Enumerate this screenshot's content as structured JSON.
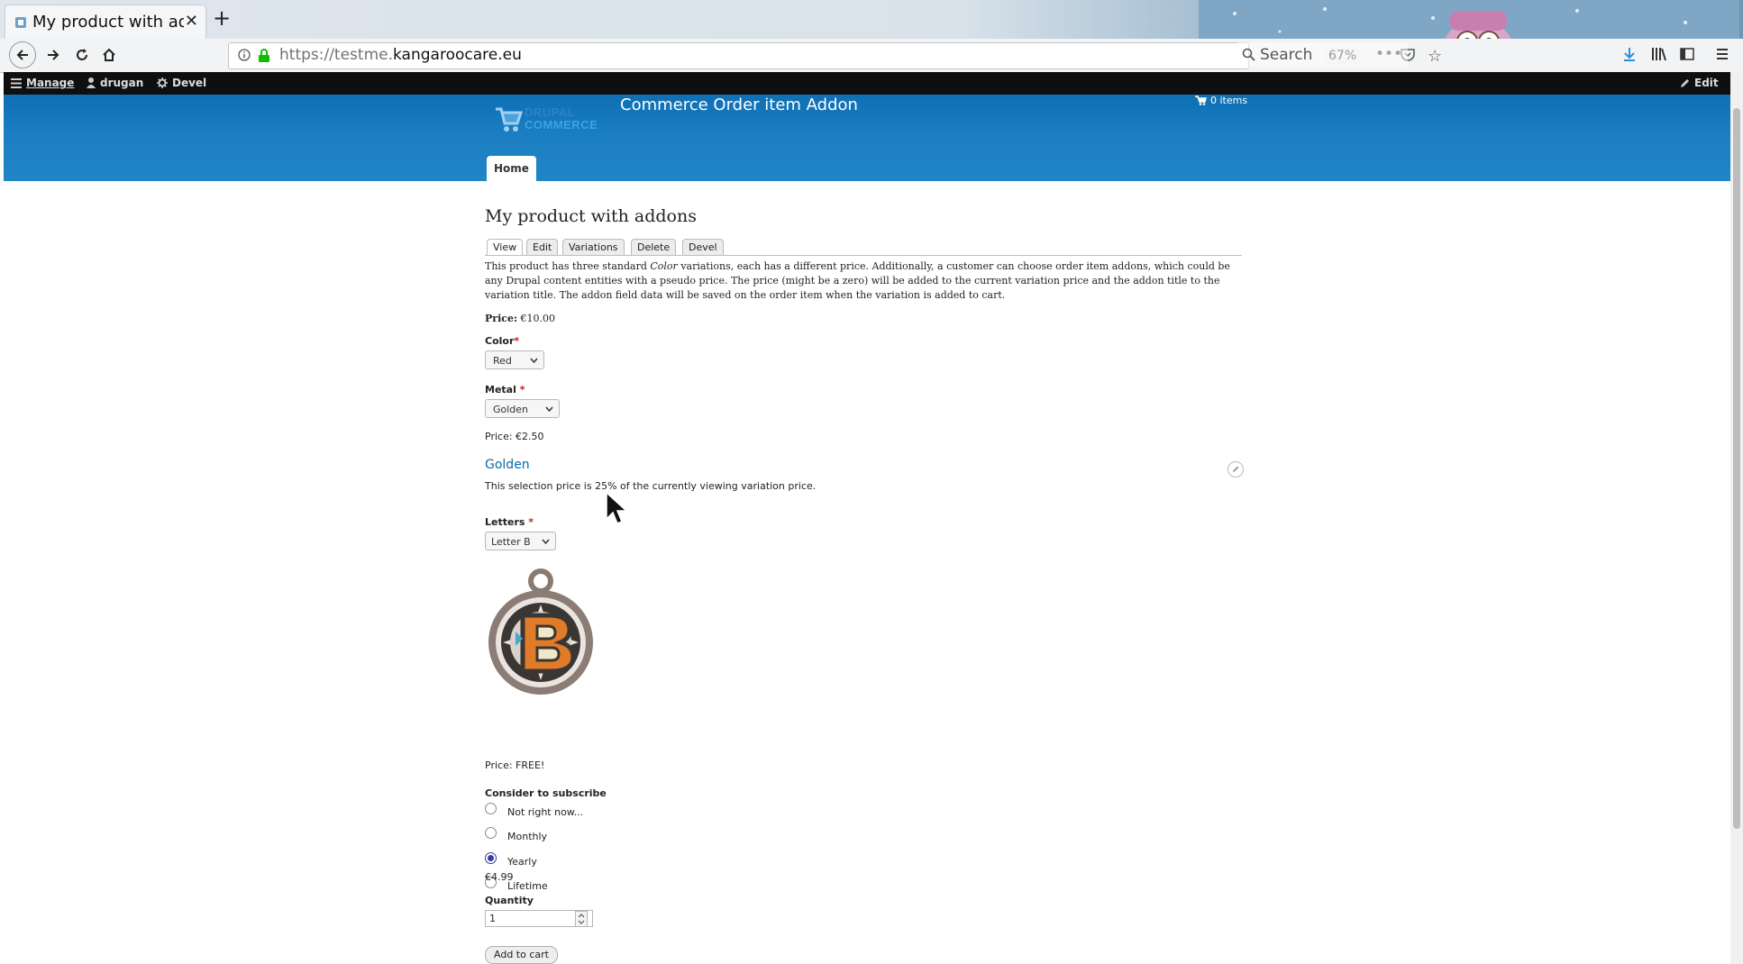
{
  "browser": {
    "tab_title": "My product with addons",
    "tab_title_visible": "My product with ad",
    "url_prefix": "https://testme.",
    "url_host": "kangaroocare.eu",
    "zoom": "67%",
    "search_placeholder": "Search"
  },
  "toolbar": {
    "manage": "Manage",
    "user": "drugan",
    "devel": "Devel",
    "edit": "Edit"
  },
  "site": {
    "logo_line1": "DRUPAL",
    "logo_line2": "COMMERCE",
    "name": "Commerce Order item Addon",
    "cart": "0 items",
    "nav_home": "Home"
  },
  "page": {
    "title": "My product with addons",
    "tabs": [
      "View",
      "Edit",
      "Variations",
      "Delete",
      "Devel"
    ],
    "description_part1": "This product has three  standard ",
    "description_em": "Color",
    "description_part2": " variations, each has a different price. Additionally, a customer can choose order item addons, which could be any Drupal content entities with a pseudo price. The price (might be a zero) will be added to the current variation price and the addon title to the variation title. The addon field data will be saved on the order item when the variation is added to cart."
  },
  "product": {
    "price_label": "Price:",
    "price_value": "€10.00",
    "color_label": "Color",
    "color_value": "Red",
    "metal_label": "Metal",
    "metal_value": "Golden",
    "metal_price": "Price: €2.50",
    "metal_link": "Golden",
    "metal_note": "This selection price is 25% of the currently viewing variation price.",
    "letters_label": "Letters",
    "letters_value": "Letter B",
    "letters_price": "Price: FREE!",
    "subscribe_label": "Consider to subscribe",
    "subscribe_options": [
      "Not right now...",
      "Monthly",
      "Yearly",
      "Lifetime"
    ],
    "subscribe_selected": "Yearly",
    "subscribe_price": "€4.99",
    "quantity_label": "Quantity",
    "quantity_value": "1",
    "add_to_cart": "Add to cart"
  },
  "colors": {
    "header_blue": "#1b7ec2",
    "link_blue": "#0b6aa8",
    "toolbar_black": "#0f0f0f"
  }
}
